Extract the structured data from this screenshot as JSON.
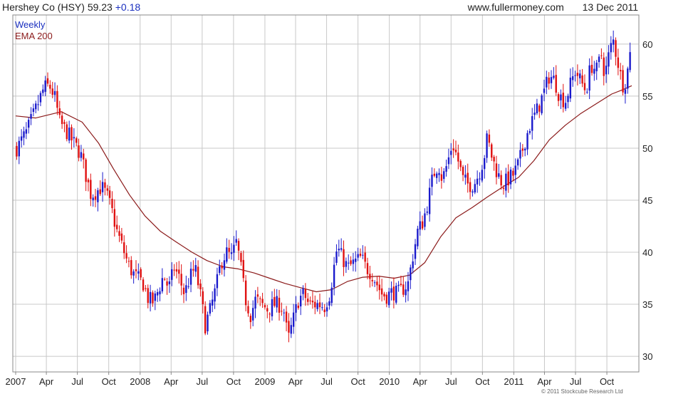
{
  "header": {
    "symbol": "Hershey Co (HSY)",
    "price": "59.23",
    "change": "+0.18",
    "site": "www.fullermoney.com",
    "date": "13 Dec 2011"
  },
  "copyright": "© 2011 Stockcube Research Ltd",
  "colors": {
    "up": "#1a1acc",
    "down": "#e01010",
    "ema": "#8b1a1a",
    "grid": "#c8c8c8",
    "frame": "#888888"
  },
  "chart_data": {
    "type": "candlestick",
    "frequency": "Weekly",
    "legend": [
      {
        "label": "Weekly",
        "color": "#1a2fbf"
      },
      {
        "label": "EMA 200",
        "color": "#8b1a1a"
      }
    ],
    "legend_position": "top-left",
    "grid": true,
    "y_axis": {
      "position": "right",
      "ylim": [
        28.5,
        62.8
      ],
      "ticks": [
        30,
        35,
        40,
        45,
        50,
        55,
        60
      ]
    },
    "x_axis": {
      "start": "2007-01-01",
      "end": "2011-12-13",
      "ticks": [
        {
          "date": "2007-01-01",
          "label": "2007"
        },
        {
          "date": "2007-04-01",
          "label": "Apr"
        },
        {
          "date": "2007-07-01",
          "label": "Jul"
        },
        {
          "date": "2007-10-01",
          "label": "Oct"
        },
        {
          "date": "2008-01-01",
          "label": "2008"
        },
        {
          "date": "2008-04-01",
          "label": "Apr"
        },
        {
          "date": "2008-07-01",
          "label": "Jul"
        },
        {
          "date": "2008-10-01",
          "label": "Oct"
        },
        {
          "date": "2009-01-01",
          "label": "2009"
        },
        {
          "date": "2009-04-01",
          "label": "Apr"
        },
        {
          "date": "2009-07-01",
          "label": "Jul"
        },
        {
          "date": "2009-10-01",
          "label": "Oct"
        },
        {
          "date": "2010-01-01",
          "label": "2010"
        },
        {
          "date": "2010-04-01",
          "label": "Apr"
        },
        {
          "date": "2010-07-01",
          "label": "Jul"
        },
        {
          "date": "2010-10-01",
          "label": "Oct"
        },
        {
          "date": "2011-01-01",
          "label": "2011"
        },
        {
          "date": "2011-04-01",
          "label": "Apr"
        },
        {
          "date": "2011-07-01",
          "label": "Jul"
        },
        {
          "date": "2011-10-01",
          "label": "Oct"
        }
      ]
    },
    "price_path": [
      [
        "2007-01-05",
        50.0
      ],
      [
        "2007-02-01",
        51.5
      ],
      [
        "2007-02-20",
        53.0
      ],
      [
        "2007-03-10",
        54.5
      ],
      [
        "2007-03-25",
        55.8
      ],
      [
        "2007-04-10",
        56.0
      ],
      [
        "2007-04-25",
        55.0
      ],
      [
        "2007-05-10",
        52.5
      ],
      [
        "2007-06-01",
        51.5
      ],
      [
        "2007-06-20",
        50.5
      ],
      [
        "2007-07-10",
        49.5
      ],
      [
        "2007-07-25",
        47.5
      ],
      [
        "2007-08-10",
        45.5
      ],
      [
        "2007-08-25",
        45.8
      ],
      [
        "2007-09-10",
        46.3
      ],
      [
        "2007-09-25",
        45.5
      ],
      [
        "2007-10-10",
        44.0
      ],
      [
        "2007-10-25",
        42.0
      ],
      [
        "2007-11-10",
        40.5
      ],
      [
        "2007-11-25",
        39.0
      ],
      [
        "2007-12-10",
        38.0
      ],
      [
        "2007-12-25",
        37.5
      ],
      [
        "2008-01-10",
        37.0
      ],
      [
        "2008-01-25",
        35.5
      ],
      [
        "2008-02-10",
        35.2
      ],
      [
        "2008-02-25",
        36.5
      ],
      [
        "2008-03-10",
        37.8
      ],
      [
        "2008-03-25",
        36.5
      ],
      [
        "2008-04-10",
        38.5
      ],
      [
        "2008-04-25",
        37.5
      ],
      [
        "2008-05-10",
        36.0
      ],
      [
        "2008-05-25",
        37.5
      ],
      [
        "2008-06-10",
        38.5
      ],
      [
        "2008-06-25",
        36.0
      ],
      [
        "2008-07-10",
        33.0
      ],
      [
        "2008-07-25",
        34.5
      ],
      [
        "2008-08-10",
        36.5
      ],
      [
        "2008-08-25",
        39.0
      ],
      [
        "2008-09-10",
        40.0
      ],
      [
        "2008-09-25",
        39.5
      ],
      [
        "2008-10-10",
        41.0
      ],
      [
        "2008-10-20",
        39.0
      ],
      [
        "2008-11-05",
        35.5
      ],
      [
        "2008-11-20",
        34.0
      ],
      [
        "2008-12-05",
        35.5
      ],
      [
        "2008-12-20",
        35.0
      ],
      [
        "2009-01-10",
        34.5
      ],
      [
        "2009-01-25",
        35.0
      ],
      [
        "2009-02-10",
        35.0
      ],
      [
        "2009-02-25",
        34.5
      ],
      [
        "2009-03-10",
        31.5
      ],
      [
        "2009-03-25",
        33.5
      ],
      [
        "2009-04-10",
        35.5
      ],
      [
        "2009-04-25",
        36.0
      ],
      [
        "2009-05-10",
        35.0
      ],
      [
        "2009-05-25",
        35.0
      ],
      [
        "2009-06-10",
        35.0
      ],
      [
        "2009-06-25",
        34.8
      ],
      [
        "2009-07-10",
        36.0
      ],
      [
        "2009-07-20",
        38.0
      ],
      [
        "2009-08-01",
        40.5
      ],
      [
        "2009-08-15",
        39.5
      ],
      [
        "2009-09-01",
        38.5
      ],
      [
        "2009-09-20",
        39.0
      ],
      [
        "2009-10-10",
        39.5
      ],
      [
        "2009-10-25",
        38.5
      ],
      [
        "2009-11-10",
        38.0
      ],
      [
        "2009-11-25",
        37.0
      ],
      [
        "2009-12-10",
        36.0
      ],
      [
        "2009-12-25",
        35.8
      ],
      [
        "2010-01-10",
        36.2
      ],
      [
        "2010-01-25",
        36.0
      ],
      [
        "2010-02-10",
        36.5
      ],
      [
        "2010-02-25",
        37.0
      ],
      [
        "2010-03-10",
        39.5
      ],
      [
        "2010-03-25",
        42.0
      ],
      [
        "2010-04-10",
        43.0
      ],
      [
        "2010-04-25",
        45.0
      ],
      [
        "2010-05-10",
        47.5
      ],
      [
        "2010-05-25",
        48.5
      ],
      [
        "2010-06-05",
        47.0
      ],
      [
        "2010-06-20",
        48.5
      ],
      [
        "2010-07-05",
        50.5
      ],
      [
        "2010-07-20",
        49.0
      ],
      [
        "2010-08-05",
        47.0
      ],
      [
        "2010-08-20",
        46.5
      ],
      [
        "2010-09-05",
        46.5
      ],
      [
        "2010-09-20",
        47.5
      ],
      [
        "2010-10-05",
        49.0
      ],
      [
        "2010-10-15",
        51.0
      ],
      [
        "2010-10-30",
        49.0
      ],
      [
        "2010-11-15",
        47.5
      ],
      [
        "2010-11-30",
        46.5
      ],
      [
        "2010-12-15",
        47.0
      ],
      [
        "2011-01-01",
        47.5
      ],
      [
        "2011-01-15",
        48.5
      ],
      [
        "2011-02-01",
        50.5
      ],
      [
        "2011-02-15",
        52.0
      ],
      [
        "2011-03-01",
        53.0
      ],
      [
        "2011-03-15",
        54.0
      ],
      [
        "2011-04-01",
        55.5
      ],
      [
        "2011-04-15",
        57.0
      ],
      [
        "2011-05-01",
        56.5
      ],
      [
        "2011-05-15",
        55.0
      ],
      [
        "2011-06-01",
        54.5
      ],
      [
        "2011-06-15",
        56.0
      ],
      [
        "2011-07-01",
        57.5
      ],
      [
        "2011-07-15",
        56.5
      ],
      [
        "2011-08-01",
        55.5
      ],
      [
        "2011-08-15",
        58.0
      ],
      [
        "2011-09-01",
        57.5
      ],
      [
        "2011-09-15",
        59.0
      ],
      [
        "2011-09-25",
        57.0
      ],
      [
        "2011-10-10",
        59.5
      ],
      [
        "2011-10-20",
        60.3
      ],
      [
        "2011-11-01",
        58.5
      ],
      [
        "2011-11-10",
        57.0
      ],
      [
        "2011-11-20",
        55.8
      ],
      [
        "2011-12-01",
        57.5
      ],
      [
        "2011-12-13",
        59.23
      ]
    ],
    "ema_200": [
      [
        "2007-01-01",
        53.1
      ],
      [
        "2007-03-01",
        52.9
      ],
      [
        "2007-05-15",
        53.5
      ],
      [
        "2007-07-15",
        52.5
      ],
      [
        "2007-09-01",
        50.5
      ],
      [
        "2007-10-15",
        48.0
      ],
      [
        "2007-12-01",
        45.5
      ],
      [
        "2008-01-15",
        43.5
      ],
      [
        "2008-03-01",
        42.0
      ],
      [
        "2008-04-15",
        41.0
      ],
      [
        "2008-06-01",
        40.0
      ],
      [
        "2008-07-15",
        39.2
      ],
      [
        "2008-09-01",
        38.6
      ],
      [
        "2008-10-15",
        38.4
      ],
      [
        "2008-12-01",
        38.0
      ],
      [
        "2009-01-15",
        37.5
      ],
      [
        "2009-03-01",
        37.0
      ],
      [
        "2009-04-15",
        36.6
      ],
      [
        "2009-06-01",
        36.2
      ],
      [
        "2009-07-15",
        36.4
      ],
      [
        "2009-09-01",
        37.2
      ],
      [
        "2009-10-15",
        37.6
      ],
      [
        "2009-12-01",
        37.7
      ],
      [
        "2010-01-15",
        37.5
      ],
      [
        "2010-03-01",
        37.8
      ],
      [
        "2010-04-15",
        39.0
      ],
      [
        "2010-06-01",
        41.5
      ],
      [
        "2010-07-15",
        43.3
      ],
      [
        "2010-09-01",
        44.3
      ],
      [
        "2010-10-15",
        45.3
      ],
      [
        "2010-12-01",
        46.3
      ],
      [
        "2011-01-15",
        47.2
      ],
      [
        "2011-03-01",
        48.8
      ],
      [
        "2011-04-15",
        50.8
      ],
      [
        "2011-06-01",
        52.2
      ],
      [
        "2011-07-15",
        53.3
      ],
      [
        "2011-09-01",
        54.3
      ],
      [
        "2011-10-15",
        55.2
      ],
      [
        "2011-11-15",
        55.6
      ],
      [
        "2011-12-13",
        56.0
      ]
    ]
  }
}
